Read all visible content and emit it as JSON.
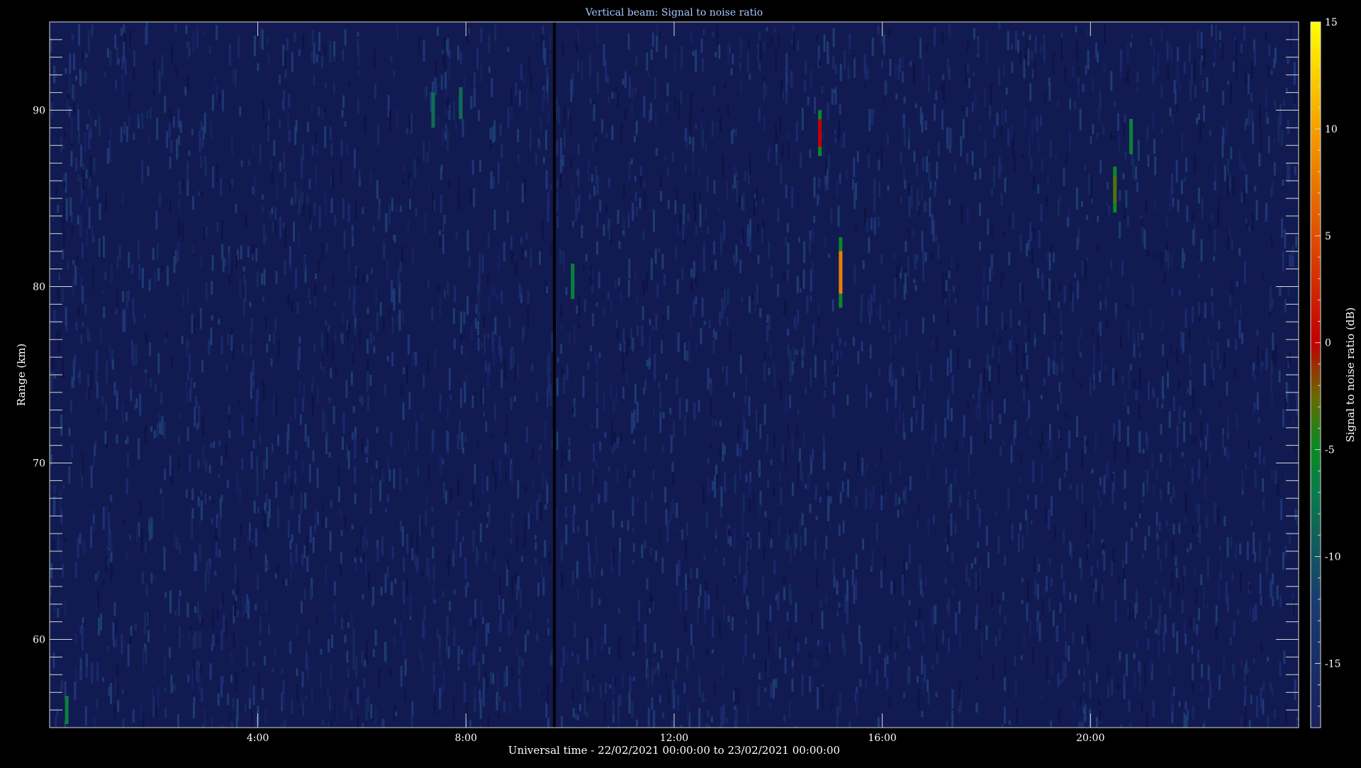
{
  "chart_data": {
    "type": "heatmap",
    "title": "Vertical beam: Signal to noise ratio",
    "xlabel": "Universal time - 22/02/2021 00:00:00 to 23/02/2021 00:00:00",
    "ylabel": "Range (km)",
    "colorbar_label": "Signal to noise ratio (dB)",
    "xlim": [
      0,
      24
    ],
    "ylim": [
      55,
      95
    ],
    "clim": [
      -18,
      15
    ],
    "x_ticks": [
      {
        "value": 4,
        "label": "4:00"
      },
      {
        "value": 8,
        "label": "8:00"
      },
      {
        "value": 12,
        "label": "12:00"
      },
      {
        "value": 16,
        "label": "16:00"
      },
      {
        "value": 20,
        "label": "20:00"
      }
    ],
    "y_ticks": [
      {
        "value": 60,
        "label": "60"
      },
      {
        "value": 70,
        "label": "70"
      },
      {
        "value": 80,
        "label": "80"
      },
      {
        "value": 90,
        "label": "90"
      }
    ],
    "colorbar_ticks": [
      {
        "value": 15,
        "label": "15"
      },
      {
        "value": 10,
        "label": "10"
      },
      {
        "value": 5,
        "label": "5"
      },
      {
        "value": 0,
        "label": "0"
      },
      {
        "value": -5,
        "label": "-5"
      },
      {
        "value": -10,
        "label": "-10"
      },
      {
        "value": -15,
        "label": "-15"
      }
    ],
    "background_snr": -15,
    "data_gap_time": 9.7,
    "echoes": [
      {
        "time": 0.33,
        "range_from": 55.2,
        "range_to": 56.8,
        "snr": -6
      },
      {
        "time": 7.37,
        "range_from": 89.0,
        "range_to": 91.0,
        "snr": -8
      },
      {
        "time": 7.9,
        "range_from": 89.5,
        "range_to": 91.3,
        "snr": -8
      },
      {
        "time": 10.05,
        "range_from": 79.3,
        "range_to": 81.3,
        "snr": -6
      },
      {
        "time": 14.8,
        "range_from": 87.4,
        "range_to": 90.0,
        "snr": 0
      },
      {
        "time": 15.2,
        "range_from": 78.8,
        "range_to": 82.8,
        "snr": 8
      },
      {
        "time": 20.47,
        "range_from": 84.2,
        "range_to": 86.8,
        "snr": -3
      },
      {
        "time": 20.78,
        "range_from": 87.5,
        "range_to": 89.5,
        "snr": -6
      }
    ]
  }
}
